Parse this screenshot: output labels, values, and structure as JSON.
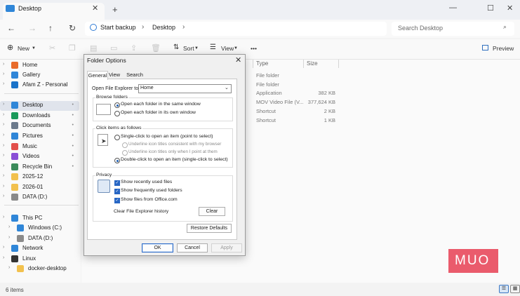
{
  "window": {
    "tab_title": "Desktop",
    "tab_close": "✕",
    "new_tab": "+",
    "minimize": "—",
    "maximize": "☐",
    "close": "✕"
  },
  "nav": {
    "back": "←",
    "forward": "→",
    "up": "↑",
    "refresh": "↻",
    "breadcrumbs": [
      "Start backup",
      "Desktop"
    ],
    "separator": "›",
    "search_placeholder": "Search Desktop"
  },
  "toolbar": {
    "new_label": "New",
    "sort_label": "Sort",
    "view_label": "View",
    "more": "•••",
    "preview_label": "Preview"
  },
  "sidebar": {
    "items": [
      {
        "label": "Home",
        "icon": "home-icon",
        "color": "#e86b2a"
      },
      {
        "label": "Gallery",
        "icon": "gallery-icon",
        "color": "#2f86d8"
      },
      {
        "label": "Afam Z - Personal",
        "icon": "cloud-icon",
        "color": "#1a73c9"
      },
      {
        "label": "Desktop",
        "icon": "desktop-icon",
        "color": "#2f86d8",
        "pinned": true,
        "selected": true
      },
      {
        "label": "Downloads",
        "icon": "downloads-icon",
        "color": "#1a9a5b",
        "pinned": true
      },
      {
        "label": "Documents",
        "icon": "documents-icon",
        "color": "#6c7a8c",
        "pinned": true
      },
      {
        "label": "Pictures",
        "icon": "pictures-icon",
        "color": "#2f86d8",
        "pinned": true
      },
      {
        "label": "Music",
        "icon": "music-icon",
        "color": "#e2504b",
        "pinned": true
      },
      {
        "label": "Videos",
        "icon": "videos-icon",
        "color": "#8a4fd6",
        "pinned": true
      },
      {
        "label": "Recycle Bin",
        "icon": "recycle-bin-icon",
        "color": "#3c8b5b",
        "pinned": true
      },
      {
        "label": "2025-12",
        "icon": "folder-icon",
        "color": "#f2c14e"
      },
      {
        "label": "2026-01",
        "icon": "folder-icon",
        "color": "#f2c14e"
      },
      {
        "label": "DATA (D:)",
        "icon": "drive-icon",
        "color": "#8a8a8a"
      },
      {
        "label": "This PC",
        "icon": "pc-icon",
        "color": "#2f86d8"
      },
      {
        "label": "Windows (C:)",
        "icon": "drive-icon",
        "color": "#2f86d8"
      },
      {
        "label": "DATA (D:)",
        "icon": "drive-icon",
        "color": "#8a8a8a"
      },
      {
        "label": "Network",
        "icon": "network-icon",
        "color": "#2f86d8"
      },
      {
        "label": "Linux",
        "icon": "linux-icon",
        "color": "#333333"
      },
      {
        "label": "docker-desktop",
        "icon": "folder-icon",
        "color": "#f2c14e"
      }
    ],
    "pin_glyph": "📌"
  },
  "files": {
    "columns": [
      "Type",
      "Size"
    ],
    "rows": [
      {
        "type": "File folder",
        "size": ""
      },
      {
        "type": "File folder",
        "size": ""
      },
      {
        "type": "Application",
        "size": "382 KB"
      },
      {
        "type": "MOV Video File (V...",
        "size": "377,624 KB"
      },
      {
        "type": "Shortcut",
        "size": "2 KB"
      },
      {
        "type": "Shortcut",
        "size": "1 KB"
      }
    ]
  },
  "status": {
    "item_count": "6 items"
  },
  "watermark": {
    "text": "MUO"
  },
  "dialog": {
    "title": "Folder Options",
    "close": "✕",
    "tabs": [
      "General",
      "View",
      "Search"
    ],
    "open_to_label": "Open File Explorer to:",
    "open_to_value": "Home",
    "browse": {
      "title": "Browse folders",
      "options": [
        "Open each folder in the same window",
        "Open each folder in its own window"
      ]
    },
    "click": {
      "title": "Click items as follows",
      "single": "Single-click to open an item (point to select)",
      "underline_browser": "Underline icon titles consistent with my browser",
      "underline_point": "Underline icon titles only when I point at them",
      "double": "Double-click to open an item (single-click to select)"
    },
    "privacy": {
      "title": "Privacy",
      "options": [
        "Show recently used files",
        "Show frequently used folders",
        "Show files from Office.com"
      ],
      "clear_label": "Clear File Explorer history",
      "clear_button": "Clear"
    },
    "restore_button": "Restore Defaults",
    "ok": "OK",
    "cancel": "Cancel",
    "apply": "Apply",
    "check": "✓"
  }
}
